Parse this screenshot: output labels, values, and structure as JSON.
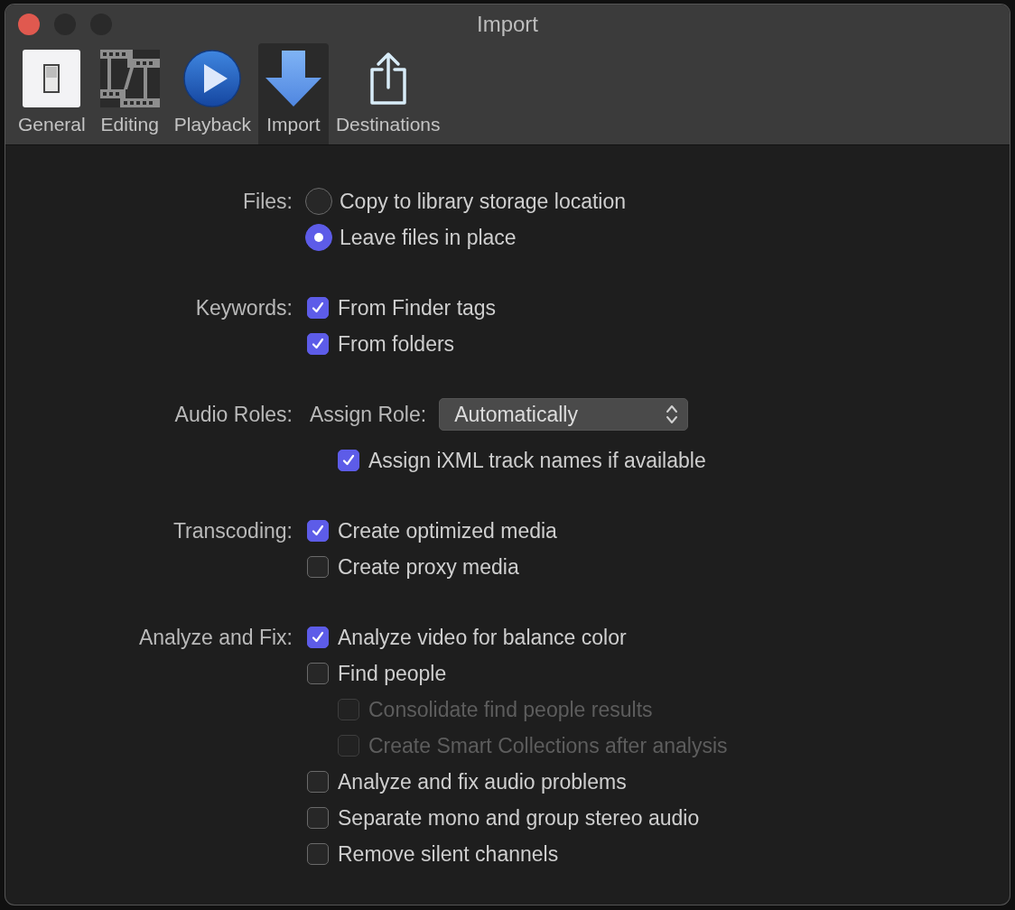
{
  "window": {
    "title": "Import"
  },
  "toolbar": [
    {
      "kind": "general",
      "label": "General",
      "selected": false
    },
    {
      "kind": "editing",
      "label": "Editing",
      "selected": false
    },
    {
      "kind": "playback",
      "label": "Playback",
      "selected": false
    },
    {
      "kind": "import",
      "label": "Import",
      "selected": true
    },
    {
      "kind": "destinations",
      "label": "Destinations",
      "selected": false
    }
  ],
  "sections": [
    {
      "label": "Files:",
      "options": [
        {
          "kind": "radio",
          "label": "Copy to library storage location",
          "selected": false
        },
        {
          "kind": "radio",
          "label": "Leave files in place",
          "selected": true
        }
      ]
    },
    {
      "label": "Keywords:",
      "options": [
        {
          "kind": "checkbox",
          "label": "From Finder tags",
          "checked": true,
          "disabled": false
        },
        {
          "kind": "checkbox",
          "label": "From folders",
          "checked": true,
          "disabled": false
        }
      ]
    },
    {
      "label": "Audio Roles:",
      "options": [
        {
          "kind": "popup",
          "label": "Assign Role:",
          "value": "Automatically",
          "children": [
            {
              "kind": "checkbox",
              "label": "Assign iXML track names if available",
              "checked": true,
              "disabled": false
            }
          ]
        }
      ]
    },
    {
      "label": "Transcoding:",
      "options": [
        {
          "kind": "checkbox",
          "label": "Create optimized media",
          "checked": true,
          "disabled": false
        },
        {
          "kind": "checkbox",
          "label": "Create proxy media",
          "checked": false,
          "disabled": false
        }
      ]
    },
    {
      "label": "Analyze and Fix:",
      "options": [
        {
          "kind": "checkbox",
          "label": "Analyze video for balance color",
          "checked": true,
          "disabled": false
        },
        {
          "kind": "checkbox",
          "label": "Find people",
          "checked": false,
          "disabled": false,
          "children": [
            {
              "kind": "checkbox",
              "label": "Consolidate find people results",
              "checked": false,
              "disabled": true
            },
            {
              "kind": "checkbox",
              "label": "Create Smart Collections after analysis",
              "checked": false,
              "disabled": true
            }
          ]
        },
        {
          "kind": "checkbox",
          "label": "Analyze and fix audio problems",
          "checked": false,
          "disabled": false
        },
        {
          "kind": "checkbox",
          "label": "Separate mono and group stereo audio",
          "checked": false,
          "disabled": false
        },
        {
          "kind": "checkbox",
          "label": "Remove silent channels",
          "checked": false,
          "disabled": false
        }
      ]
    }
  ]
}
